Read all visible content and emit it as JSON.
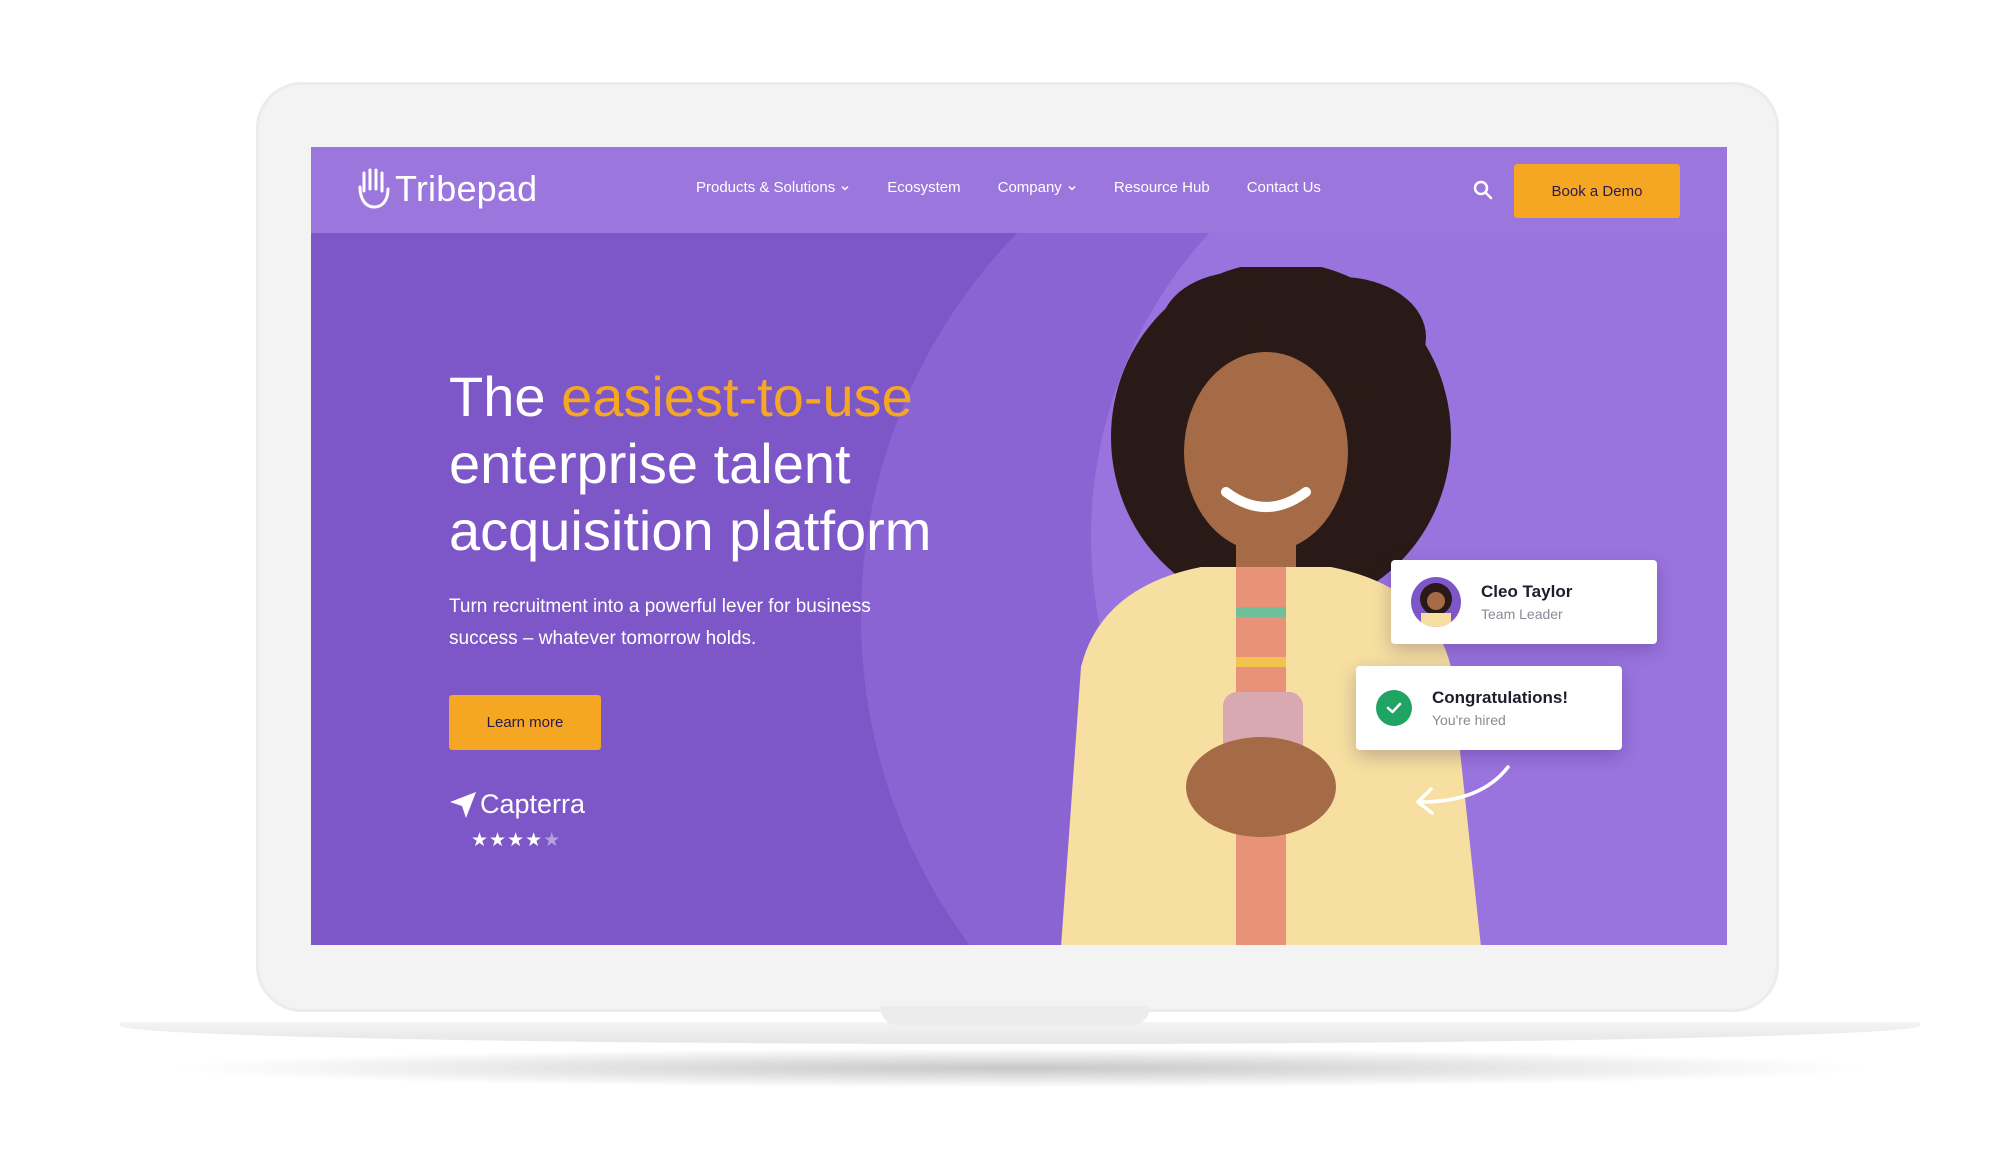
{
  "brand": {
    "name": "Tribepad",
    "accent": "#f5a623",
    "purple": "#7d57c7",
    "nav_purple": "#9b76dc"
  },
  "nav": {
    "items": [
      {
        "label": "Products & Solutions",
        "has_dropdown": true
      },
      {
        "label": "Ecosystem",
        "has_dropdown": false
      },
      {
        "label": "Company",
        "has_dropdown": true
      },
      {
        "label": "Resource Hub",
        "has_dropdown": false
      },
      {
        "label": "Contact Us",
        "has_dropdown": false
      }
    ],
    "search_icon": "search-icon",
    "cta_label": "Book a Demo"
  },
  "hero": {
    "headline_prefix": "The ",
    "headline_accent": "easiest-to-use",
    "headline_rest": "enterprise talent acquisition platform",
    "subtext": "Turn recruitment into a powerful lever for business success – whatever tomorrow holds.",
    "cta_label": "Learn more",
    "review_brand": "Capterra",
    "rating_stars": 4.5
  },
  "cards": {
    "profile": {
      "name": "Cleo Taylor",
      "role": "Team Leader"
    },
    "status": {
      "title": "Congratulations!",
      "subtitle": "You're hired"
    }
  }
}
